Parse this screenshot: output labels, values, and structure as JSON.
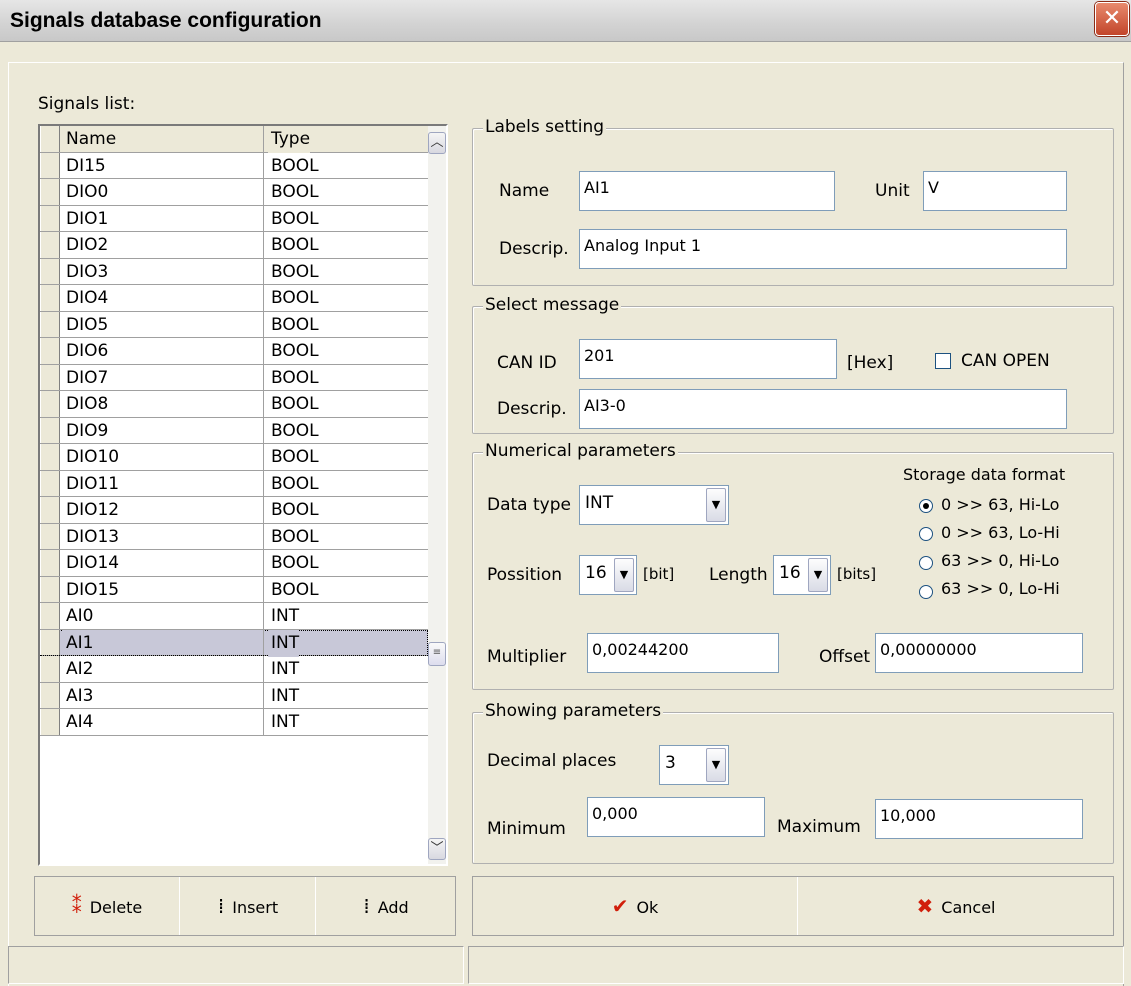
{
  "window": {
    "title": "Signals database configuration"
  },
  "signals_list": {
    "caption": "Signals list:",
    "columns": [
      "Name",
      "Type"
    ],
    "rows": [
      {
        "name": "DI15",
        "type": "BOOL"
      },
      {
        "name": "DIO0",
        "type": "BOOL"
      },
      {
        "name": "DIO1",
        "type": "BOOL"
      },
      {
        "name": "DIO2",
        "type": "BOOL"
      },
      {
        "name": "DIO3",
        "type": "BOOL"
      },
      {
        "name": "DIO4",
        "type": "BOOL"
      },
      {
        "name": "DIO5",
        "type": "BOOL"
      },
      {
        "name": "DIO6",
        "type": "BOOL"
      },
      {
        "name": "DIO7",
        "type": "BOOL"
      },
      {
        "name": "DIO8",
        "type": "BOOL"
      },
      {
        "name": "DIO9",
        "type": "BOOL"
      },
      {
        "name": "DIO10",
        "type": "BOOL"
      },
      {
        "name": "DIO11",
        "type": "BOOL"
      },
      {
        "name": "DIO12",
        "type": "BOOL"
      },
      {
        "name": "DIO13",
        "type": "BOOL"
      },
      {
        "name": "DIO14",
        "type": "BOOL"
      },
      {
        "name": "DIO15",
        "type": "BOOL"
      },
      {
        "name": "AI0",
        "type": "INT"
      },
      {
        "name": "AI1",
        "type": "INT",
        "selected": true
      },
      {
        "name": "AI2",
        "type": "INT"
      },
      {
        "name": "AI3",
        "type": "INT"
      },
      {
        "name": "AI4",
        "type": "INT"
      }
    ],
    "buttons": {
      "delete": "Delete",
      "insert": "Insert",
      "add": "Add"
    }
  },
  "labels_setting": {
    "title": "Labels setting",
    "name_label": "Name",
    "name_value": "AI1",
    "unit_label": "Unit",
    "unit_value": "V",
    "descrip_label": "Descrip.",
    "descrip_value": "Analog Input 1"
  },
  "select_message": {
    "title": "Select message",
    "canid_label": "CAN ID",
    "canid_value": "201",
    "hex_label": "[Hex]",
    "canopen_label": "CAN OPEN",
    "canopen_checked": false,
    "descrip_label": "Descrip.",
    "descrip_value": "AI3-0"
  },
  "numerical_parameters": {
    "title": "Numerical parameters",
    "datatype_label": "Data type",
    "datatype_value": "INT",
    "storage_title": "Storage data format",
    "storage_options": [
      "0 >> 63, Hi-Lo",
      "0 >> 63, Lo-Hi",
      "63 >> 0, Hi-Lo",
      "63 >> 0, Lo-Hi"
    ],
    "storage_selected": 0,
    "position_label": "Possition",
    "position_value": "16",
    "bit_label": "[bit]",
    "length_label": "Length",
    "length_value": "16",
    "bits_label": "[bits]",
    "multiplier_label": "Multiplier",
    "multiplier_value": "0,00244200",
    "offset_label": "Offset",
    "offset_value": "0,00000000"
  },
  "showing_parameters": {
    "title": "Showing parameters",
    "decimal_label": "Decimal places",
    "decimal_value": "3",
    "minimum_label": "Minimum",
    "minimum_value": "0,000",
    "maximum_label": "Maximum",
    "maximum_value": "10,000"
  },
  "dialog_buttons": {
    "ok": "Ok",
    "cancel": "Cancel"
  },
  "colors": {
    "face": "#ece9d8",
    "selection": "#c8c8d8",
    "ok_check": "#d11f0b",
    "cancel_x": "#d11f0b"
  },
  "icons": [
    "close-icon",
    "delete-icon",
    "insert-icon",
    "add-icon",
    "ok-check-icon",
    "cancel-x-icon",
    "scroll-up-icon",
    "scroll-down-icon",
    "dropdown-arrow-icon"
  ]
}
